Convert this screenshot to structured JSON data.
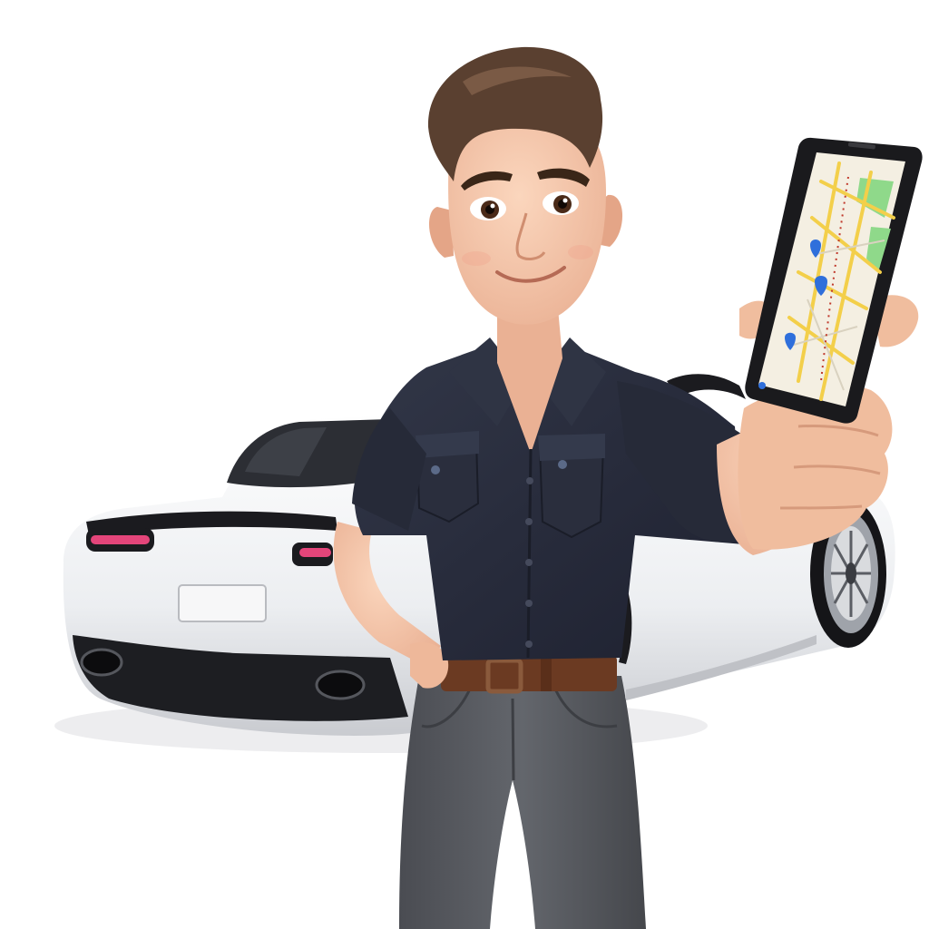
{
  "scene": {
    "background": "#ffffff",
    "subject": "cartoon-man-with-phone",
    "props": [
      "sports-car",
      "smartphone-map"
    ]
  },
  "colors": {
    "skin": "#f3c6a8",
    "skin_shadow": "#e0a98a",
    "hair": "#5a4030",
    "shirt": "#272b38",
    "shirt_shadow": "#1c1f29",
    "pants": "#575a60",
    "belt": "#6b3a22",
    "car_body": "#f2f2f4",
    "car_shadow": "#cfd0d4",
    "car_trim": "#1b1b1f",
    "tail_light": "#e4457a",
    "phone_body": "#1a1a1d",
    "map_base": "#f4efe2",
    "map_road": "#f3cf4a",
    "map_park": "#8fd98a",
    "map_pin": "#2f6fdb"
  }
}
